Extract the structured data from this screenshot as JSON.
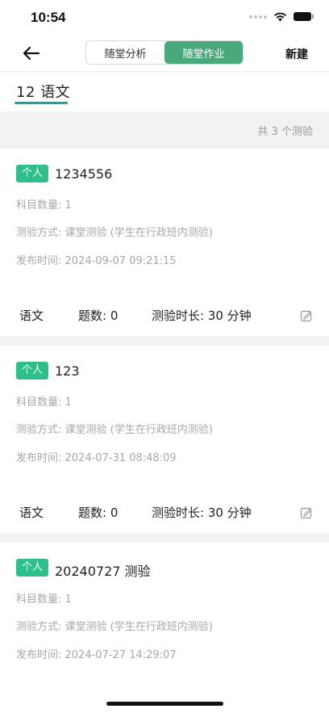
{
  "status_bar": {
    "time": "10:54"
  },
  "nav": {
    "segments": [
      {
        "label": "随堂分析",
        "active": false
      },
      {
        "label": "随堂作业",
        "active": true
      }
    ],
    "new_label": "新建"
  },
  "tab": {
    "label": "12 语文"
  },
  "summary": {
    "text": "共 3 个测验"
  },
  "quizzes": [
    {
      "badge": "个人",
      "title": "1234556",
      "subject_count": "科目数量: 1",
      "method": "测验方式: 课堂测验 (学生在行政班内测验)",
      "published": "发布时间: 2024-09-07 09:21:15",
      "subject": "语文",
      "question_count": "题数: 0",
      "duration": "测验时长: 30 分钟"
    },
    {
      "badge": "个人",
      "title": "123",
      "subject_count": "科目数量: 1",
      "method": "测验方式: 课堂测验 (学生在行政班内测验)",
      "published": "发布时间: 2024-07-31 08:48:09",
      "subject": "语文",
      "question_count": "题数: 0",
      "duration": "测验时长: 30 分钟"
    },
    {
      "badge": "个人",
      "title": "20240727 测验",
      "subject_count": "科目数量: 1",
      "method": "测验方式: 课堂测验 (学生在行政班内测验)",
      "published": "发布时间: 2024-07-27 14:29:07"
    }
  ],
  "colors": {
    "accent": "#4aa97b",
    "badge": "#2fbf8a",
    "tab_underline": "#3f9590",
    "muted_text": "#a8a8a8",
    "separator": "#f2f2f2"
  }
}
